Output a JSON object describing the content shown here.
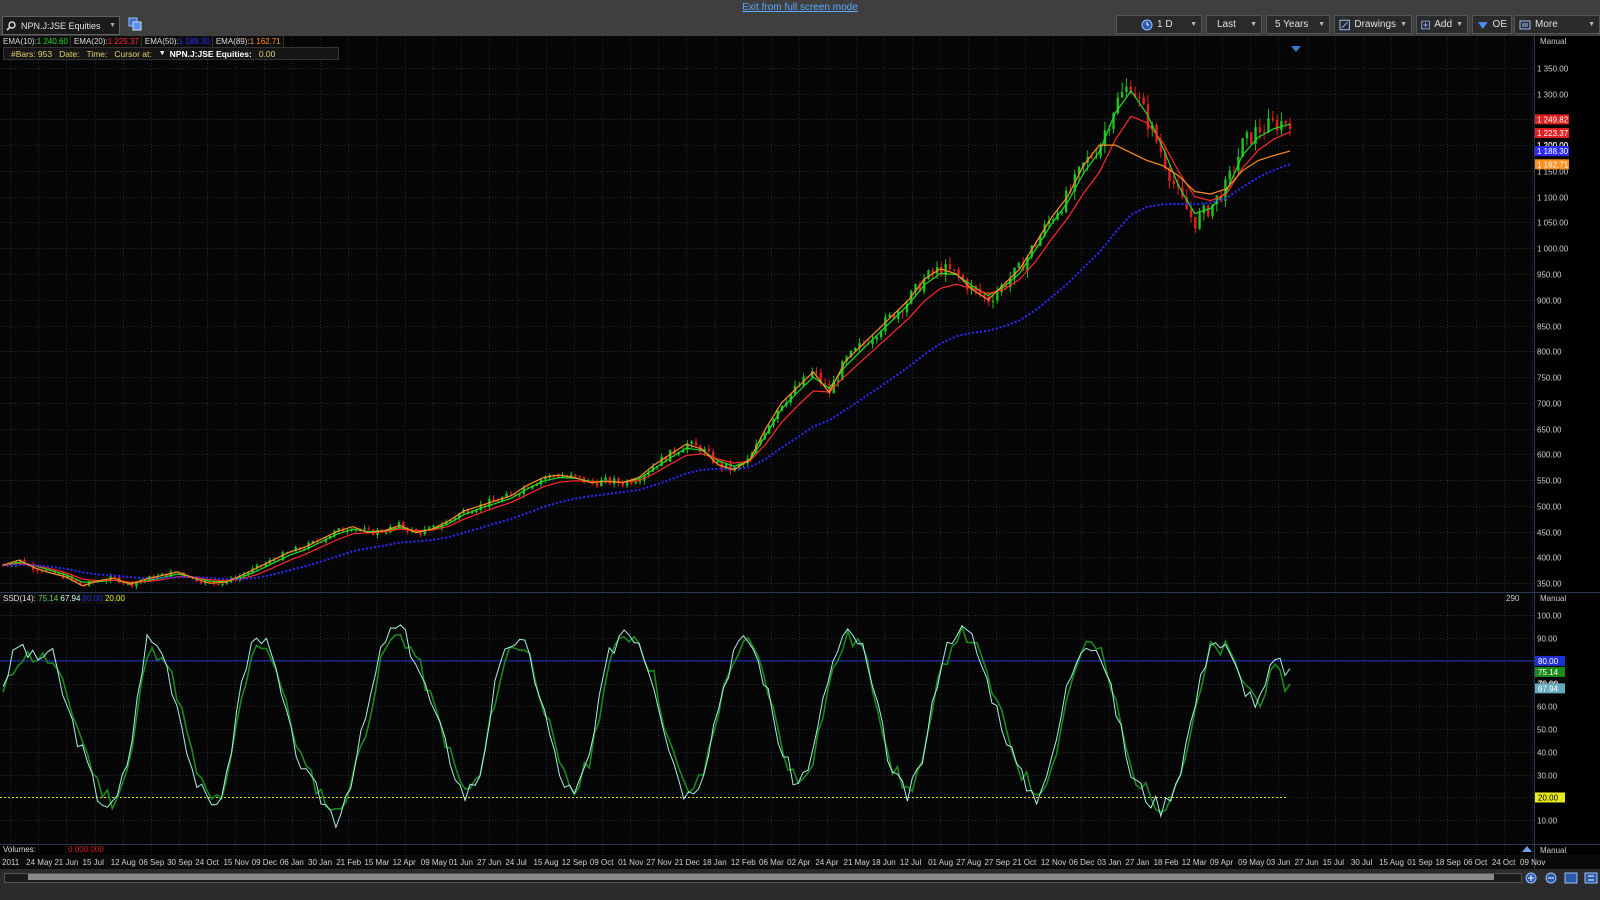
{
  "app": {
    "exit_fullscreen": "Exit from full screen mode",
    "symbol_input": "NPN.J:JSE Equities",
    "toolbar": {
      "interval": "1 D",
      "price": "Last",
      "range": "5 Years",
      "drawings": "Drawings",
      "add": "Add",
      "oe": "OE",
      "more": "More"
    },
    "price_legend": {
      "ema10_label": "EMA(10):",
      "ema10_value": "1 240.60",
      "ema20_label": "EMA(20):",
      "ema20_value": "1 225.37",
      "ema50_label": "EMA(50):",
      "ema50_value": "1 188.30",
      "ema89_label": "EMA(89):",
      "ema89_value": "1 162.71"
    },
    "info_bar": {
      "bars": "#Bars: 953",
      "date": "Date:",
      "time": "Time:",
      "cursor": "Cursor at:",
      "symbol": "NPN.J:JSE Equities:",
      "cursor_value": "0.00"
    },
    "manual_label": "Manual",
    "ssd_legend": {
      "label": "SSD(14):",
      "k": "75.14",
      "d": "67.94",
      "upper": "80.00",
      "lower": "20.00"
    },
    "ssd_counter": "290",
    "volumes_label": "Volumes:",
    "volumes_value": "0.000.000",
    "colors": {
      "up": "#1fc21f",
      "down": "#e02020",
      "ema10": "#22dd22",
      "ema20": "#ff2a2a",
      "ema50": "#2a2aff",
      "ema89": "#ff9020",
      "ssd_k": "#a8f0e8",
      "ssd_d": "#1a8a1a",
      "upper_line": "#2030d0",
      "lower_line": "#e8e820"
    }
  },
  "chart_data": [
    {
      "type": "line",
      "name": "price",
      "ylim": [
        335,
        1365
      ],
      "y_ticks": [
        350,
        400,
        450,
        500,
        550,
        600,
        650,
        700,
        750,
        800,
        850,
        900,
        950,
        1000,
        1050,
        1100,
        1150,
        1200,
        1250,
        1300,
        1350
      ],
      "y_tick_labels": [
        "350.00",
        "400.00",
        "450.00",
        "500.00",
        "550.00",
        "600.00",
        "650.00",
        "700.00",
        "750.00",
        "800.00",
        "850.00",
        "900.00",
        "950.00",
        "1 000.00",
        "1 050.00",
        "1 100.00",
        "1 150.00",
        "1 200.00",
        "1 250.00",
        "1 300.00",
        "1 350.00"
      ],
      "x_ticks": [
        "2011",
        "24 May",
        "21 Jun",
        "15 Jul",
        "12 Aug",
        "06 Sep",
        "30 Sep",
        "24 Oct",
        "15 Nov",
        "09 Dec",
        "06 Jan",
        "30 Jan",
        "21 Feb",
        "15 Mar",
        "12 Apr",
        "09 May",
        "01 Jun",
        "27 Jun",
        "24 Jul",
        "15 Aug",
        "12 Sep",
        "09 Oct",
        "01 Nov",
        "27 Nov",
        "21 Dec",
        "18 Jan",
        "12 Feb",
        "06 Mar",
        "02 Apr",
        "24 Apr",
        "21 May",
        "18 Jun",
        "12 Jul",
        "01 Aug",
        "27 Aug",
        "27 Sep",
        "21 Oct",
        "12 Nov",
        "06 Dec",
        "03 Jan",
        "27 Jan",
        "18 Feb",
        "12 Mar",
        "09 Apr",
        "09 May",
        "03 Jun",
        "27 Jun",
        "15 Jul",
        "30 Jul",
        "15 Aug",
        "01 Sep",
        "18 Sep",
        "06 Oct",
        "24 Oct",
        "09 Nov"
      ],
      "closes": [
        385,
        395,
        380,
        370,
        362,
        345,
        355,
        360,
        348,
        358,
        365,
        372,
        360,
        350,
        352,
        365,
        380,
        395,
        410,
        420,
        435,
        450,
        460,
        448,
        452,
        462,
        448,
        455,
        470,
        490,
        500,
        510,
        520,
        540,
        555,
        560,
        555,
        545,
        548,
        545,
        555,
        580,
        600,
        620,
        610,
        580,
        570,
        590,
        650,
        700,
        730,
        760,
        720,
        780,
        810,
        840,
        870,
        900,
        940,
        960,
        950,
        920,
        900,
        930,
        960,
        1010,
        1060,
        1100,
        1160,
        1200,
        1280,
        1320,
        1250,
        1180,
        1100,
        1050,
        1080,
        1120,
        1200,
        1230,
        1240,
        1250
      ],
      "series": [
        {
          "name": "EMA(10)",
          "values": [
            385,
            390,
            384,
            375,
            366,
            352,
            353,
            356,
            350,
            354,
            361,
            368,
            362,
            354,
            353,
            361,
            374,
            389,
            404,
            415,
            430,
            445,
            455,
            450,
            451,
            458,
            451,
            454,
            465,
            483,
            495,
            505,
            515,
            533,
            548,
            555,
            554,
            547,
            548,
            546,
            552,
            572,
            593,
            612,
            608,
            588,
            577,
            587,
            637,
            688,
            720,
            750,
            728,
            770,
            801,
            831,
            861,
            891,
            929,
            951,
            949,
            927,
            908,
            925,
            952,
            998,
            1047,
            1089,
            1145,
            1187,
            1262,
            1305,
            1260,
            1195,
            1120,
            1067,
            1077,
            1110,
            1180,
            1215,
            1232,
            1240.6
          ]
        },
        {
          "name": "EMA(20)",
          "values": [
            385,
            388,
            385,
            378,
            370,
            358,
            355,
            356,
            352,
            353,
            357,
            363,
            362,
            357,
            355,
            358,
            367,
            380,
            394,
            406,
            420,
            434,
            446,
            448,
            450,
            455,
            452,
            453,
            460,
            474,
            486,
            497,
            507,
            522,
            537,
            546,
            549,
            547,
            547,
            546,
            549,
            563,
            581,
            598,
            601,
            591,
            583,
            587,
            620,
            662,
            694,
            723,
            721,
            752,
            780,
            808,
            836,
            864,
            898,
            922,
            930,
            922,
            912,
            920,
            940,
            975,
            1018,
            1058,
            1106,
            1147,
            1210,
            1256,
            1243,
            1205,
            1148,
            1100,
            1092,
            1105,
            1155,
            1190,
            1212,
            1225.37
          ]
        },
        {
          "name": "EMA(50)",
          "values": [
            385,
            386,
            385,
            382,
            378,
            371,
            367,
            365,
            362,
            360,
            360,
            362,
            362,
            360,
            358,
            358,
            361,
            367,
            375,
            383,
            392,
            402,
            412,
            418,
            423,
            429,
            431,
            434,
            439,
            448,
            457,
            466,
            475,
            486,
            498,
            507,
            514,
            519,
            523,
            527,
            531,
            540,
            551,
            563,
            570,
            572,
            572,
            575,
            591,
            613,
            633,
            654,
            666,
            686,
            706,
            727,
            748,
            770,
            794,
            815,
            829,
            836,
            840,
            848,
            860,
            880,
            905,
            931,
            962,
            992,
            1030,
            1065,
            1080,
            1085,
            1086,
            1085,
            1088,
            1097,
            1118,
            1137,
            1152,
            1162.71
          ]
        },
        {
          "name": "EMA(89)",
          "values": [
            385,
            395,
            380,
            370,
            362,
            345,
            355,
            360,
            348,
            358,
            365,
            372,
            360,
            350,
            352,
            365,
            380,
            395,
            410,
            420,
            435,
            450,
            460,
            448,
            452,
            462,
            448,
            455,
            470,
            490,
            500,
            510,
            520,
            540,
            555,
            560,
            555,
            545,
            548,
            545,
            555,
            580,
            600,
            620,
            610,
            580,
            570,
            590,
            650,
            700,
            730,
            760,
            720,
            780,
            810,
            840,
            870,
            900,
            940,
            960,
            950,
            920,
            900,
            930,
            960,
            1010,
            1060,
            1100,
            1160,
            1200,
            1200,
            1185,
            1170,
            1160,
            1140,
            1110,
            1105,
            1115,
            1150,
            1170,
            1180,
            1188.3
          ]
        }
      ],
      "last_labels": [
        "1 249.82",
        "1 223.37",
        "1 200.00",
        "1 188.30",
        "1 162.71"
      ]
    },
    {
      "type": "line",
      "name": "SSD(14)",
      "ylim": [
        0,
        105
      ],
      "y_ticks": [
        10,
        20,
        30,
        40,
        50,
        60,
        70,
        80,
        90,
        100
      ],
      "y_tick_labels": [
        "10.00",
        "20.00",
        "30.00",
        "40.00",
        "50.00",
        "60.00",
        "70.00",
        "80.00",
        "90.00",
        "100.00"
      ],
      "levels": [
        80,
        20
      ],
      "level_labels": [
        "80.00",
        "20.00"
      ],
      "k_values": [
        70,
        88,
        80,
        85,
        60,
        40,
        20,
        15,
        40,
        90,
        85,
        60,
        30,
        15,
        25,
        70,
        95,
        80,
        50,
        30,
        20,
        10,
        30,
        60,
        90,
        95,
        80,
        60,
        40,
        20,
        30,
        70,
        90,
        85,
        60,
        30,
        20,
        40,
        80,
        95,
        90,
        70,
        40,
        20,
        30,
        60,
        85,
        90,
        70,
        40,
        25,
        40,
        75,
        92,
        88,
        60,
        30,
        20,
        40,
        80,
        95,
        90,
        70,
        50,
        30,
        20,
        35,
        70,
        90,
        85,
        60,
        30,
        20,
        15,
        30,
        60,
        90,
        85,
        70,
        60,
        80,
        75.14
      ],
      "d_values": [
        65,
        82,
        82,
        80,
        65,
        45,
        25,
        18,
        35,
        82,
        85,
        65,
        35,
        18,
        22,
        62,
        90,
        82,
        55,
        33,
        22,
        12,
        28,
        55,
        85,
        92,
        82,
        62,
        42,
        22,
        28,
        65,
        88,
        85,
        62,
        33,
        22,
        38,
        75,
        92,
        90,
        72,
        42,
        22,
        28,
        58,
        82,
        88,
        72,
        42,
        26,
        38,
        70,
        90,
        88,
        62,
        33,
        22,
        38,
        75,
        92,
        90,
        72,
        52,
        32,
        22,
        32,
        65,
        88,
        85,
        62,
        32,
        22,
        16,
        28,
        55,
        85,
        85,
        72,
        62,
        75,
        67.94
      ],
      "last_labels": [
        "80.00",
        "75.14",
        "70.00",
        "67.94"
      ]
    }
  ]
}
